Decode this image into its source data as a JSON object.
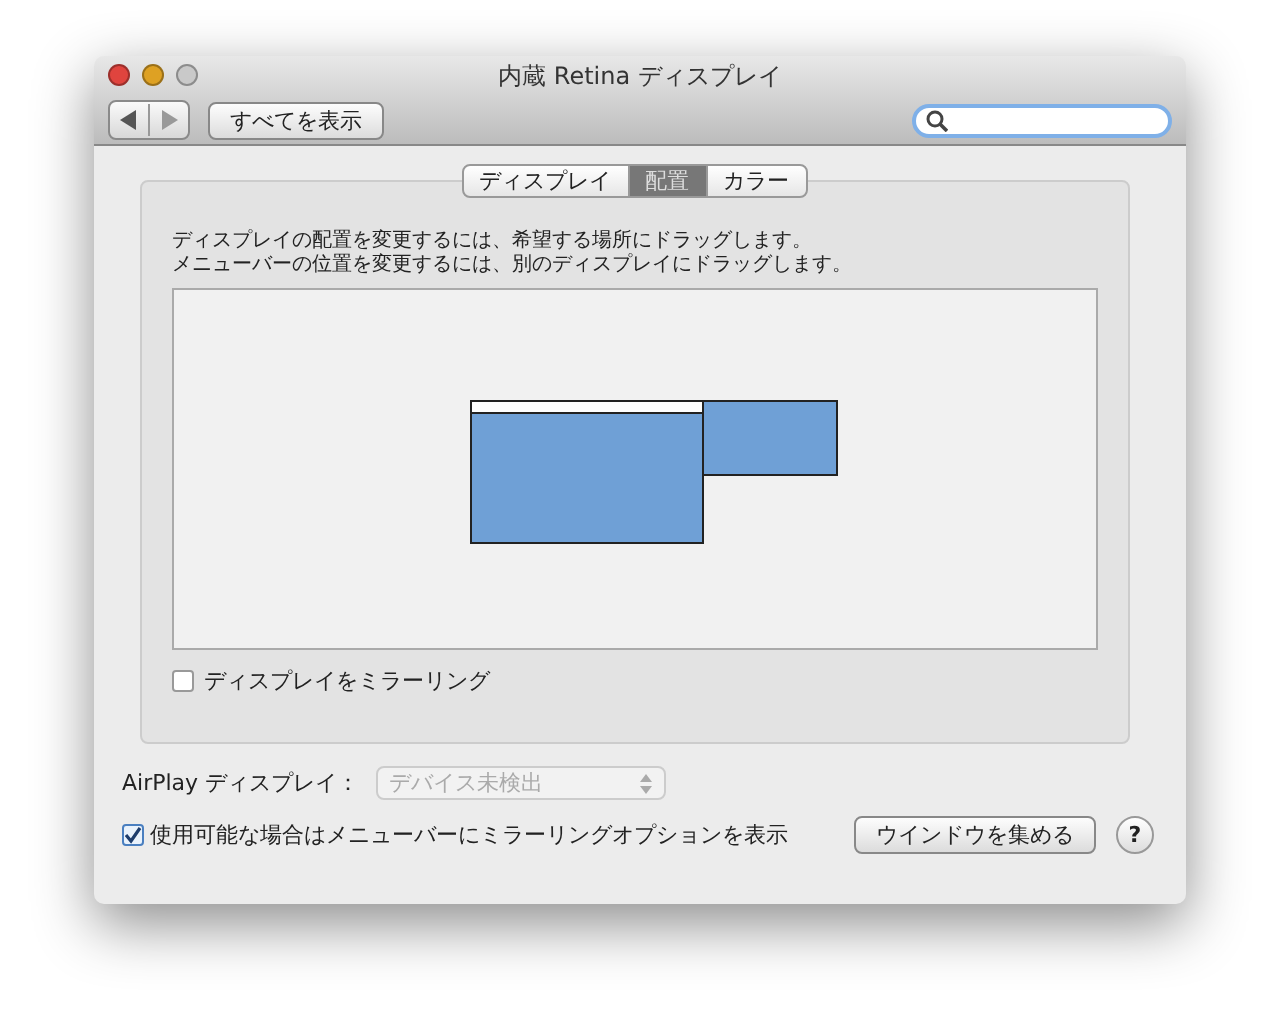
{
  "window": {
    "title": "内蔵 Retina ディスプレイ"
  },
  "toolbar": {
    "show_all": "すべてを表示"
  },
  "tabs": [
    {
      "label": "ディスプレイ",
      "selected": false
    },
    {
      "label": "配置",
      "selected": true
    },
    {
      "label": "カラー",
      "selected": false
    }
  ],
  "instructions": [
    "ディスプレイの配置を変更するには、希望する場所にドラッグします。",
    "メニューバーの位置を変更するには、別のディスプレイにドラッグします。"
  ],
  "displays": [
    {
      "menu_bar": true
    },
    {
      "menu_bar": false
    }
  ],
  "mirror": {
    "label": "ディスプレイをミラーリング",
    "checked": false
  },
  "airplay": {
    "label": "AirPlay ディスプレイ：",
    "value": "デバイス未検出",
    "disabled": true
  },
  "show_options": {
    "label": "使用可能な場合はメニューバーにミラーリングオプションを表示",
    "checked": true
  },
  "gather_button": "ウインドウを集める",
  "help": "?"
}
